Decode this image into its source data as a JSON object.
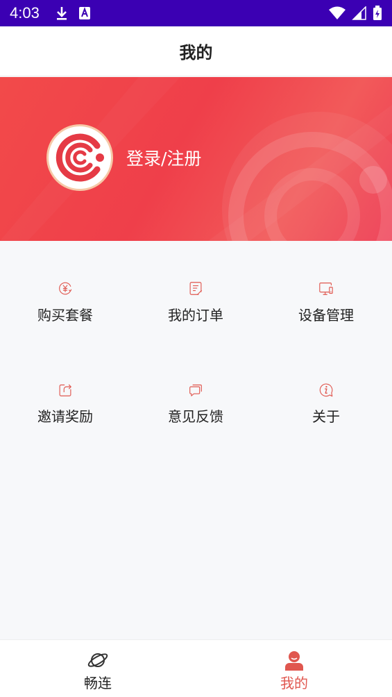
{
  "status_bar": {
    "time": "4:03",
    "icons": [
      "download-icon",
      "a-icon",
      "wifi-icon",
      "signal-icon",
      "battery-icon"
    ]
  },
  "header": {
    "title": "我的"
  },
  "profile": {
    "login_label": "登录/注册",
    "avatar_icon": "app-logo"
  },
  "menu": [
    {
      "label": "购买套餐",
      "icon": "yuan-coin-icon"
    },
    {
      "label": "我的订单",
      "icon": "order-list-icon"
    },
    {
      "label": "设备管理",
      "icon": "devices-icon"
    },
    {
      "label": "邀请奖励",
      "icon": "share-icon"
    },
    {
      "label": "意见反馈",
      "icon": "feedback-icon"
    },
    {
      "label": "关于",
      "icon": "info-icon"
    }
  ],
  "bottom_nav": [
    {
      "label": "畅连",
      "icon": "planet-icon",
      "active": false
    },
    {
      "label": "我的",
      "icon": "user-icon",
      "active": true
    }
  ],
  "colors": {
    "accent": "#e0574f",
    "status_bar": "#3b00b3",
    "banner": "#ef3f4a",
    "nav_inactive": "#222222"
  }
}
